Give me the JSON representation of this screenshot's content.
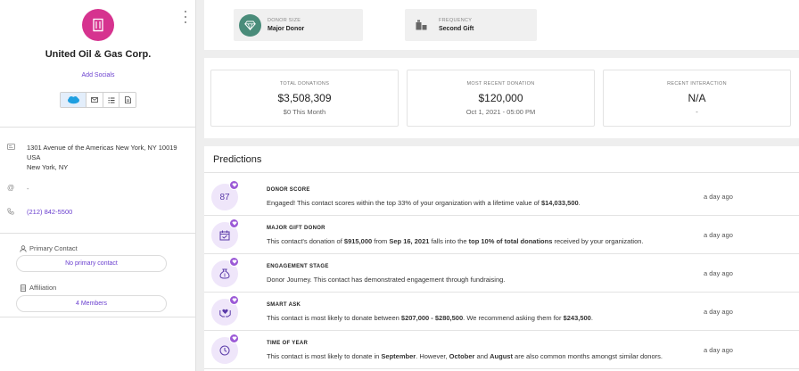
{
  "sidebar": {
    "org_name": "United Oil & Gas Corp.",
    "add_socials": "Add Socials",
    "address_lines": [
      "1301 Avenue of the Americas New York, NY 10019",
      "USA",
      "New York, NY"
    ],
    "email": "-",
    "phone": "(212) 842-5500",
    "primary_contact_label": "Primary Contact",
    "primary_contact_value": "No primary contact",
    "affiliation_label": "Affiliation",
    "affiliation_value": "4 Members",
    "avatar_color": "#d6338f",
    "accent_color": "#6a3fcf"
  },
  "attributes": [
    {
      "label": "DONOR SIZE",
      "value": "Major Donor",
      "icon": "diamond-icon"
    },
    {
      "label": "FREQUENCY",
      "value": "Second Gift",
      "icon": "gifts-icon"
    }
  ],
  "stats": [
    {
      "label": "TOTAL DONATIONS",
      "value": "$3,508,309",
      "sub": "$0 This Month"
    },
    {
      "label": "MOST RECENT DONATION",
      "value": "$120,000",
      "sub": "Oct 1, 2021 - 05:00 PM"
    },
    {
      "label": "RECENT INTERACTION",
      "value": "N/A",
      "sub": "-"
    }
  ],
  "predictions": {
    "title": "Predictions",
    "items": [
      {
        "title": "DONOR SCORE",
        "score": "87",
        "time": "a day ago",
        "segments": [
          [
            "Engaged! This contact scores within the top 33% of your organization with a lifetime value of ",
            false
          ],
          [
            "$14,033,500",
            true
          ],
          [
            ".",
            false
          ]
        ]
      },
      {
        "title": "MAJOR GIFT DONOR",
        "time": "a day ago",
        "segments": [
          [
            "This contact's donation of ",
            false
          ],
          [
            "$915,000",
            true
          ],
          [
            " from ",
            false
          ],
          [
            "Sep 16, 2021",
            true
          ],
          [
            " falls into the ",
            false
          ],
          [
            "top 10% of total donations",
            true
          ],
          [
            " received by your organization.",
            false
          ]
        ]
      },
      {
        "title": "ENGAGEMENT STAGE",
        "time": "a day ago",
        "segments": [
          [
            "Donor Journey. This contact has demonstrated engagement through fundraising.",
            false
          ]
        ]
      },
      {
        "title": "SMART ASK",
        "time": "a day ago",
        "segments": [
          [
            "This contact is most likely to donate between ",
            false
          ],
          [
            "$207,000 - $280,500",
            true
          ],
          [
            ". We recommend asking them for ",
            false
          ],
          [
            "$243,500",
            true
          ],
          [
            ".",
            false
          ]
        ]
      },
      {
        "title": "TIME OF YEAR",
        "time": "a day ago",
        "segments": [
          [
            "This contact is most likely to donate in ",
            false
          ],
          [
            "September",
            true
          ],
          [
            ". However, ",
            false
          ],
          [
            "October",
            true
          ],
          [
            " and ",
            false
          ],
          [
            "August",
            true
          ],
          [
            " are also common months amongst similar donors.",
            false
          ]
        ]
      }
    ]
  }
}
